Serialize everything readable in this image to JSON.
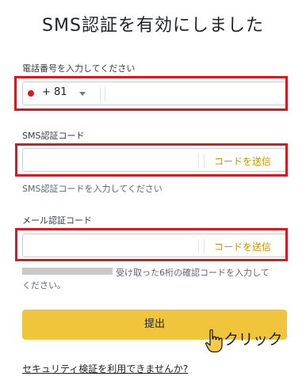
{
  "page": {
    "title": "SMS認証を有効にしました"
  },
  "phone": {
    "label": "電話番号を入力してください",
    "country_code": "+ 81",
    "value": ""
  },
  "sms": {
    "label": "SMS認証コード",
    "value": "",
    "send_button": "コードを送信",
    "hint": "SMS認証コードを入力してください"
  },
  "email": {
    "label": "メール認証コード",
    "value": "",
    "send_button": "コードを送信",
    "hint_line1": "受け取った6桁の確認コードを入力して",
    "hint_line2": "ください。"
  },
  "submit": {
    "label": "提出"
  },
  "annotation": {
    "click_text": "クリック"
  },
  "help": {
    "link": "セキュリティ検証を利用できませんか?"
  },
  "colors": {
    "accent_yellow": "#f0c53b",
    "link_gold": "#c99400",
    "highlight_red": "#d71920"
  }
}
